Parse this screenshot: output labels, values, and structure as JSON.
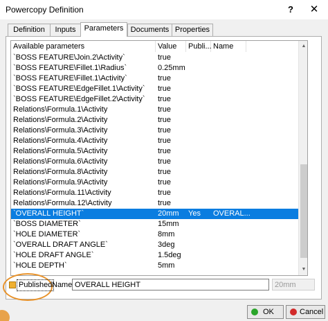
{
  "window": {
    "title": "Powercopy Definition",
    "help_glyph": "?",
    "close_glyph": "✕"
  },
  "tabs": [
    {
      "label": "Definition",
      "active": false
    },
    {
      "label": "Inputs",
      "active": false
    },
    {
      "label": "Parameters",
      "active": true
    },
    {
      "label": "Documents",
      "active": false
    },
    {
      "label": "Properties",
      "active": false
    }
  ],
  "table": {
    "columns": [
      "Available parameters",
      "Value",
      "Publi...",
      "Name"
    ],
    "rows": [
      {
        "param": "`BOSS FEATURE\\Join.2\\Activity`",
        "value": "true",
        "published": "",
        "name": ""
      },
      {
        "param": "`BOSS FEATURE\\Fillet.1\\Radius`",
        "value": "0.25mm",
        "published": "",
        "name": ""
      },
      {
        "param": "`BOSS FEATURE\\Fillet.1\\Activity`",
        "value": "true",
        "published": "",
        "name": ""
      },
      {
        "param": "`BOSS FEATURE\\EdgeFillet.1\\Activity`",
        "value": "true",
        "published": "",
        "name": ""
      },
      {
        "param": "`BOSS FEATURE\\EdgeFillet.2\\Activity`",
        "value": "true",
        "published": "",
        "name": ""
      },
      {
        "param": "Relations\\Formula.1\\Activity",
        "value": "true",
        "published": "",
        "name": ""
      },
      {
        "param": "Relations\\Formula.2\\Activity",
        "value": "true",
        "published": "",
        "name": ""
      },
      {
        "param": "Relations\\Formula.3\\Activity",
        "value": "true",
        "published": "",
        "name": ""
      },
      {
        "param": "Relations\\Formula.4\\Activity",
        "value": "true",
        "published": "",
        "name": ""
      },
      {
        "param": "Relations\\Formula.5\\Activity",
        "value": "true",
        "published": "",
        "name": ""
      },
      {
        "param": "Relations\\Formula.6\\Activity",
        "value": "true",
        "published": "",
        "name": ""
      },
      {
        "param": "Relations\\Formula.8\\Activity",
        "value": "true",
        "published": "",
        "name": ""
      },
      {
        "param": "Relations\\Formula.9\\Activity",
        "value": "true",
        "published": "",
        "name": ""
      },
      {
        "param": "Relations\\Formula.11\\Activity",
        "value": "true",
        "published": "",
        "name": ""
      },
      {
        "param": "Relations\\Formula.12\\Activity",
        "value": "true",
        "published": "",
        "name": ""
      },
      {
        "param": "`OVERALL HEIGHT`",
        "value": "20mm",
        "published": "Yes",
        "name": "OVERAL...",
        "selected": true
      },
      {
        "param": "`BOSS DIAMETER`",
        "value": "15mm",
        "published": "",
        "name": ""
      },
      {
        "param": "`HOLE DIAMETER`",
        "value": "8mm",
        "published": "",
        "name": ""
      },
      {
        "param": "`OVERALL DRAFT ANGLE`",
        "value": "3deg",
        "published": "",
        "name": ""
      },
      {
        "param": "`HOLE DRAFT ANGLE`",
        "value": "1.5deg",
        "published": "",
        "name": ""
      },
      {
        "param": "`HOLE DEPTH`",
        "value": "5mm",
        "published": "",
        "name": ""
      }
    ]
  },
  "bottom": {
    "published_label": "Published",
    "name_label": "Name:",
    "name_value": "OVERALL HEIGHT",
    "value_field": "20mm"
  },
  "buttons": {
    "ok": "OK",
    "cancel": "Cancel"
  },
  "colors": {
    "selection": "#0a7de0",
    "highlight_ring": "#e8922a"
  },
  "icons": {
    "published": "published-flag-icon",
    "ok": "ok-icon",
    "cancel": "cancel-icon"
  }
}
